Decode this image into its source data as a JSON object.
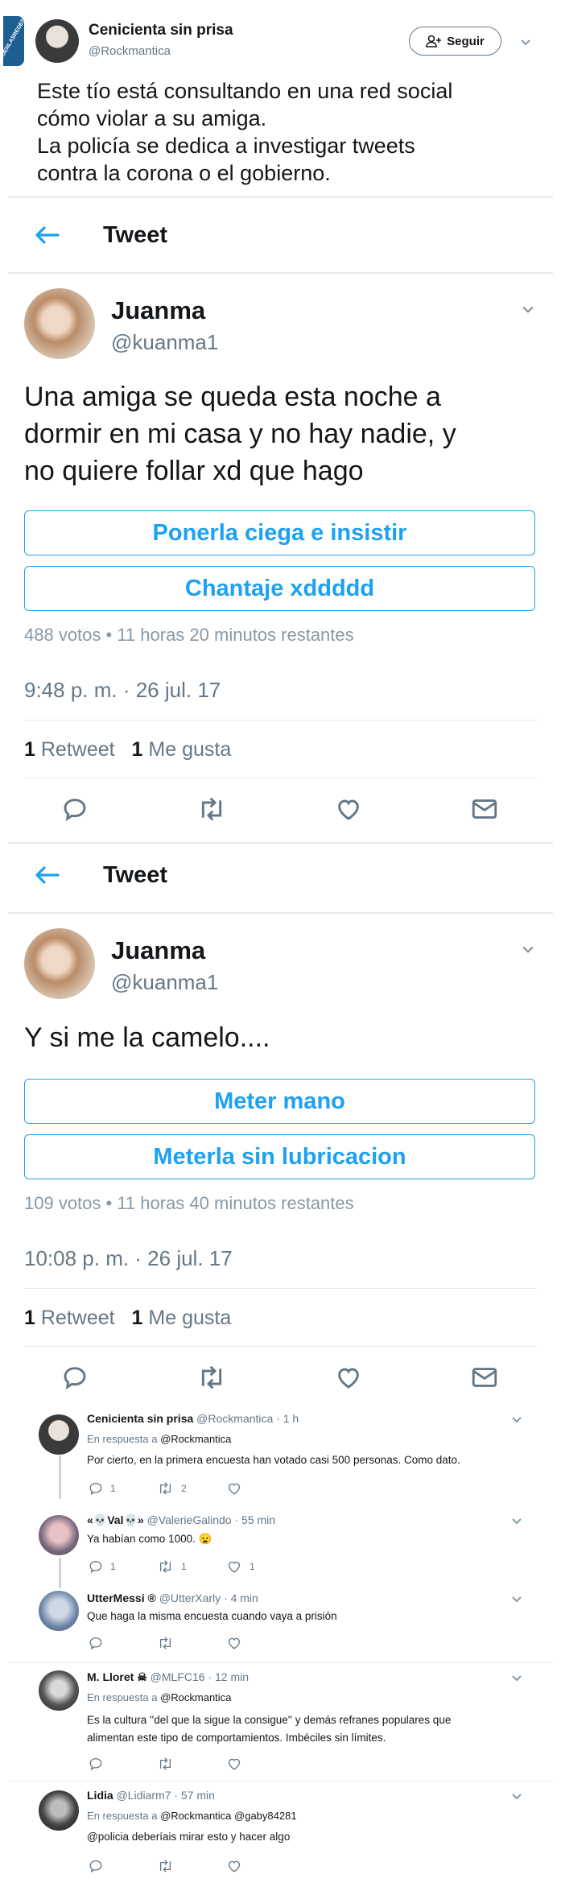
{
  "top_tweet": {
    "name": "Cenicienta sin prisa",
    "handle": "@Rockmantica",
    "follow_label": "Seguir",
    "watermark": "VISTOENLASREDES.com",
    "text_lines": [
      "Este tío está consultando en una red social",
      "cómo violar a su amiga.",
      "La policía se dedica a investigar tweets",
      "contra la corona o el gobierno."
    ]
  },
  "screens": [
    {
      "header": "Tweet",
      "name": "Juanma",
      "handle": "@kuanma1",
      "text_lines": [
        "Una amiga se queda esta noche a",
        "dormir en mi casa y no hay nadie, y",
        "no quiere follar xd que hago"
      ],
      "poll_options": [
        "Ponerla ciega e insistir",
        "Chantaje xddddd"
      ],
      "poll_meta": "488 votos • 11 horas 20 minutos restantes",
      "timestamp": "9:48 p. m. · 26 jul. 17",
      "retweets_count": "1",
      "retweets_label": "Retweet",
      "likes_count": "1",
      "likes_label": "Me gusta"
    },
    {
      "header": "Tweet",
      "name": "Juanma",
      "handle": "@kuanma1",
      "text_lines": [
        "Y si me la camelo...."
      ],
      "poll_options": [
        "Meter mano",
        "Meterla sin lubricacion"
      ],
      "poll_meta": "109 votos • 11 horas 40 minutos restantes",
      "timestamp": "10:08 p. m. · 26 jul. 17",
      "retweets_count": "1",
      "retweets_label": "Retweet",
      "likes_count": "1",
      "likes_label": "Me gusta"
    }
  ],
  "replies": [
    {
      "name": "Cenicienta sin prisa",
      "handle_time": "@Rockmantica · 1 h",
      "reply_to_prefix": "En respuesta a",
      "reply_to": "@Rockmantica",
      "text_lines": [
        "Por cierto, en la primera encuesta han votado casi 500 personas. Como dato."
      ],
      "counts": [
        "1",
        "2",
        ""
      ]
    },
    {
      "name": "«💀Val💀»",
      "handle_time": "@ValerieGalindo · 55 min",
      "reply_to_prefix": "",
      "reply_to": "",
      "text_lines": [
        "Ya habían como 1000. 😦"
      ],
      "counts": [
        "1",
        "1",
        "1"
      ]
    },
    {
      "name": "UtterMessi ®",
      "handle_time": "@UtterXarly · 4 min",
      "reply_to_prefix": "",
      "reply_to": "",
      "text_lines": [
        "Que haga la misma encuesta cuando vaya a prisión"
      ],
      "counts": [
        "",
        "",
        ""
      ]
    },
    {
      "name": "M. Lloret ☠",
      "handle_time": "@MLFC16 · 12 min",
      "reply_to_prefix": "En respuesta a",
      "reply_to": "@Rockmantica",
      "text_lines": [
        "Es la cultura ''del que la sigue la consigue'' y demás refranes populares que",
        "alimentan este tipo de comportamientos. Imbéciles sin límites."
      ],
      "counts": [
        "",
        "",
        ""
      ]
    },
    {
      "name": "Lidia",
      "handle_time": "@Lidiarm7 · 57 min",
      "reply_to_prefix": "En respuesta a",
      "reply_to": "@Rockmantica @gaby84281",
      "text_lines": [
        "@policia deberíais mirar esto y hacer algo"
      ],
      "counts": [
        "",
        "",
        ""
      ]
    }
  ],
  "colors": {
    "accent": "#1da1f2",
    "text": "#14171a",
    "muted": "#8899a6",
    "divider": "#e6ecf0"
  },
  "icons": [
    "back-arrow-icon",
    "chevron-down-icon",
    "reply-icon",
    "retweet-icon",
    "like-icon",
    "dm-icon",
    "add-user-icon"
  ]
}
